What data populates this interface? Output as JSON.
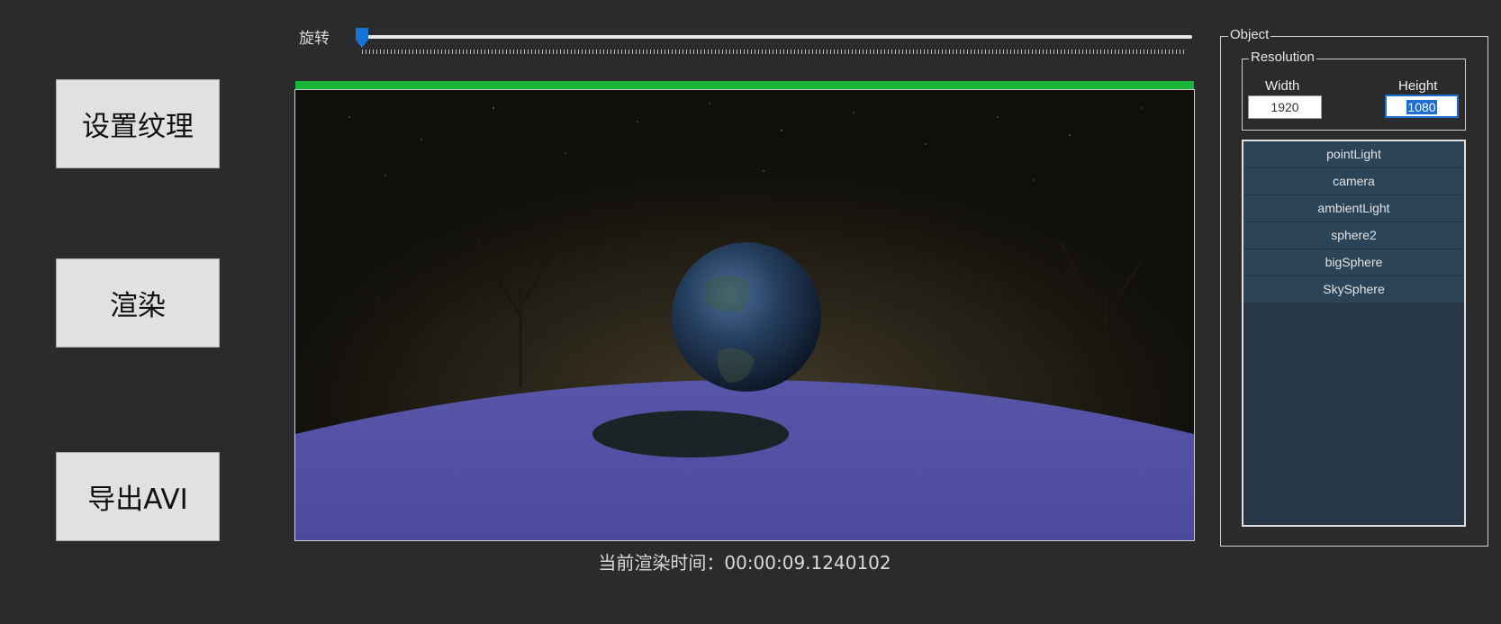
{
  "buttons": {
    "set_texture": "设置纹理",
    "render": "渲染",
    "export_avi": "导出AVI"
  },
  "slider": {
    "label": "旋转",
    "value_fraction": 0.0
  },
  "render": {
    "progress_fraction": 1.0,
    "time_label": "当前渲染时间：00:00:09.1240102"
  },
  "object_panel": {
    "title": "Object",
    "resolution": {
      "title": "Resolution",
      "width_label": "Width",
      "height_label": "Height",
      "width_value": "1920",
      "height_value": "1080"
    },
    "items": [
      "pointLight",
      "camera",
      "ambientLight",
      "sphere2",
      "bigSphere",
      "SkySphere"
    ]
  },
  "colors": {
    "background": "#2b2b2d",
    "progress": "#18b538",
    "slider_thumb": "#1773d6",
    "list_bg": "#263747",
    "list_item": "#2c4458",
    "ground": "#4f4ea4"
  }
}
